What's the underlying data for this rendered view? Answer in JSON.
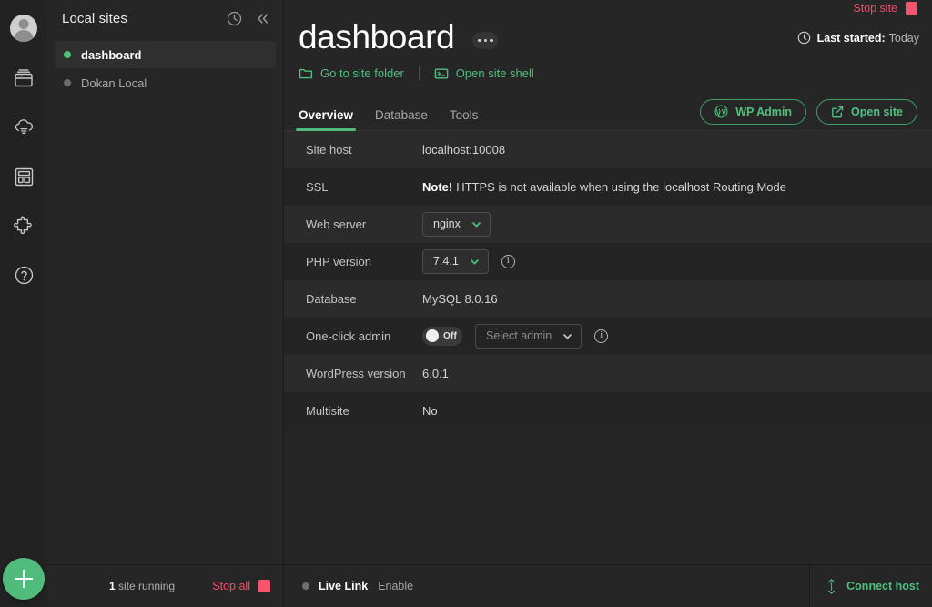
{
  "rail": {
    "icons": [
      {
        "name": "avatar",
        "label": "Account"
      },
      {
        "name": "sites-icon",
        "label": "Local sites"
      },
      {
        "name": "cloud-backup-icon",
        "label": "Cloud backups"
      },
      {
        "name": "blueprints-icon",
        "label": "Blueprints"
      },
      {
        "name": "add-ons-icon",
        "label": "Add-ons"
      },
      {
        "name": "help-icon",
        "label": "Help"
      }
    ],
    "add_button_label": "+"
  },
  "sidebar": {
    "title": "Local sites",
    "history_icon": "clock-icon",
    "collapse_icon": "double-chevron-left-icon",
    "items": [
      {
        "label": "dashboard",
        "running": true,
        "active": true
      },
      {
        "label": "Dokan Local",
        "running": false,
        "active": false
      }
    ],
    "footer": {
      "count": "1",
      "running_text": "site running",
      "stop_all_label": "Stop all"
    }
  },
  "header": {
    "stop_site_label": "Stop site",
    "title": "dashboard",
    "more_menu_label": "•••",
    "last_started_label": "Last started:",
    "last_started_value": "Today",
    "links": [
      {
        "label": "Go to site folder",
        "icon": "folder-icon"
      },
      {
        "label": "Open site shell",
        "icon": "terminal-icon"
      }
    ]
  },
  "tabs": [
    {
      "label": "Overview",
      "active": true
    },
    {
      "label": "Database",
      "active": false
    },
    {
      "label": "Tools",
      "active": false
    }
  ],
  "tab_actions": [
    {
      "label": "WP Admin",
      "icon": "wordpress-icon"
    },
    {
      "label": "Open site",
      "icon": "external-link-icon"
    }
  ],
  "overview_rows": [
    {
      "label": "Site host",
      "type": "text",
      "value": "localhost:10008"
    },
    {
      "label": "SSL",
      "type": "note",
      "note": "Note!",
      "value": "HTTPS is not available when using the localhost Routing Mode"
    },
    {
      "label": "Web server",
      "type": "select",
      "value": "nginx"
    },
    {
      "label": "PHP version",
      "type": "select",
      "value": "7.4.1",
      "info": true
    },
    {
      "label": "Database",
      "type": "text",
      "value": "MySQL 8.0.16"
    },
    {
      "label": "One-click admin",
      "type": "toggle",
      "toggle_state": "Off",
      "select_placeholder": "Select admin",
      "info": true
    },
    {
      "label": "WordPress version",
      "type": "text",
      "value": "6.0.1"
    },
    {
      "label": "Multisite",
      "type": "text",
      "value": "No"
    }
  ],
  "bottom": {
    "live_link_label": "Live Link",
    "live_link_action": "Enable",
    "connect_host_label": "Connect host",
    "connect_host_icon": "connect-icon"
  },
  "colors": {
    "accent_green": "#51bb7b",
    "danger_red": "#f0506a",
    "bg": "#262626",
    "rail_bg": "#222222",
    "row_alt": "#2b2b2b",
    "row_base": "#242424"
  }
}
